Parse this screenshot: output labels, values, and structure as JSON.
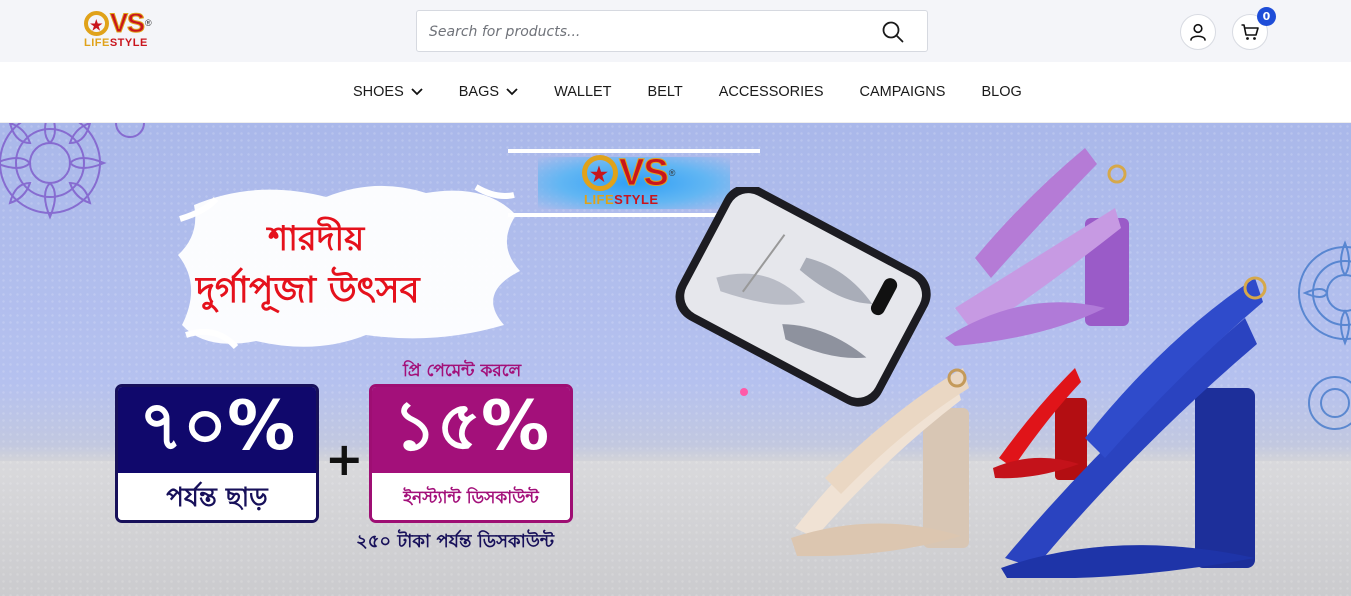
{
  "brand": {
    "logo_main": "VS",
    "logo_sub_1": "LIFE",
    "logo_sub_2": "STYLE",
    "logo_mark": "®"
  },
  "search": {
    "placeholder": "Search for products..."
  },
  "cart": {
    "count": "0"
  },
  "nav": {
    "items": [
      {
        "label": "SHOES",
        "has_dropdown": true
      },
      {
        "label": "BAGS",
        "has_dropdown": true
      },
      {
        "label": "WALLET",
        "has_dropdown": false
      },
      {
        "label": "BELT",
        "has_dropdown": false
      },
      {
        "label": "ACCESSORIES",
        "has_dropdown": false
      },
      {
        "label": "CAMPAIGNS",
        "has_dropdown": false
      },
      {
        "label": "BLOG",
        "has_dropdown": false
      }
    ]
  },
  "hero": {
    "festival_line1": "শারদীয়",
    "festival_line2": "দুর্গাপূজা উৎসব",
    "discount_percent": "৭০%",
    "discount_caption": "পর্যন্ত ছাড়",
    "prepay_note": "প্রি পেমেন্ট করলে",
    "instant_percent": "১৫%",
    "instant_caption": "ইনস্ট্যান্ট ডিসকাউন্ট",
    "upto_note": "২৫০ টাকা পর্যন্ত ডিসকাউন্ট",
    "plus_sign": "+"
  },
  "colors": {
    "topbar_bg": "#f4f5f9",
    "brand_red": "#c9151d",
    "brand_gold": "#e0a21a",
    "badge_blue": "#1e4dd8",
    "navy": "#10086c",
    "magenta": "#a3107a",
    "festival_red": "#e5111c"
  }
}
